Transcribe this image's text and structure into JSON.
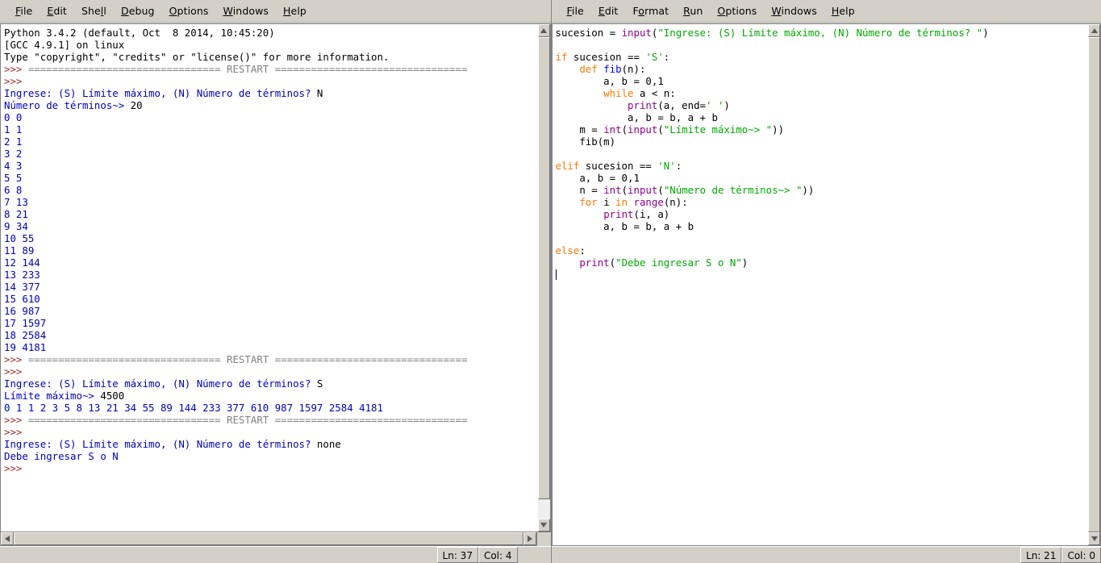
{
  "shell_window": {
    "menu": [
      {
        "label": "File",
        "mnemonic": "F"
      },
      {
        "label": "Edit",
        "mnemonic": "E"
      },
      {
        "label": "Shell",
        "mnemonic": "l"
      },
      {
        "label": "Debug",
        "mnemonic": "D"
      },
      {
        "label": "Options",
        "mnemonic": "O"
      },
      {
        "label": "Windows",
        "mnemonic": "W"
      },
      {
        "label": "Help",
        "mnemonic": "H"
      }
    ],
    "status": {
      "line_label": "Ln: 37",
      "col_label": "Col: 4"
    },
    "lines": [
      [
        {
          "t": "Python 3.4.2 (default, Oct  8 2014, 10:45:20)",
          "c": "normal"
        }
      ],
      [
        {
          "t": "[GCC 4.9.1] on linux",
          "c": "normal"
        }
      ],
      [
        {
          "t": "Type \"copyright\", \"credits\" or \"license()\" for more information.",
          "c": "normal"
        }
      ],
      [
        {
          "t": ">>> ",
          "c": "prompt"
        },
        {
          "t": "================================ RESTART ================================",
          "c": "restart"
        }
      ],
      [
        {
          "t": ">>> ",
          "c": "prompt"
        }
      ],
      [
        {
          "t": "Ingrese: (S) Límite máximo, (N) Número de términos? ",
          "c": "stdout"
        },
        {
          "t": "N",
          "c": "stdin"
        }
      ],
      [
        {
          "t": "Número de términos~> ",
          "c": "stdout"
        },
        {
          "t": "20",
          "c": "stdin"
        }
      ],
      [
        {
          "t": "0 0",
          "c": "stdout"
        }
      ],
      [
        {
          "t": "1 1",
          "c": "stdout"
        }
      ],
      [
        {
          "t": "2 1",
          "c": "stdout"
        }
      ],
      [
        {
          "t": "3 2",
          "c": "stdout"
        }
      ],
      [
        {
          "t": "4 3",
          "c": "stdout"
        }
      ],
      [
        {
          "t": "5 5",
          "c": "stdout"
        }
      ],
      [
        {
          "t": "6 8",
          "c": "stdout"
        }
      ],
      [
        {
          "t": "7 13",
          "c": "stdout"
        }
      ],
      [
        {
          "t": "8 21",
          "c": "stdout"
        }
      ],
      [
        {
          "t": "9 34",
          "c": "stdout"
        }
      ],
      [
        {
          "t": "10 55",
          "c": "stdout"
        }
      ],
      [
        {
          "t": "11 89",
          "c": "stdout"
        }
      ],
      [
        {
          "t": "12 144",
          "c": "stdout"
        }
      ],
      [
        {
          "t": "13 233",
          "c": "stdout"
        }
      ],
      [
        {
          "t": "14 377",
          "c": "stdout"
        }
      ],
      [
        {
          "t": "15 610",
          "c": "stdout"
        }
      ],
      [
        {
          "t": "16 987",
          "c": "stdout"
        }
      ],
      [
        {
          "t": "17 1597",
          "c": "stdout"
        }
      ],
      [
        {
          "t": "18 2584",
          "c": "stdout"
        }
      ],
      [
        {
          "t": "19 4181",
          "c": "stdout"
        }
      ],
      [
        {
          "t": ">>> ",
          "c": "prompt"
        },
        {
          "t": "================================ RESTART ================================",
          "c": "restart"
        }
      ],
      [
        {
          "t": ">>> ",
          "c": "prompt"
        }
      ],
      [
        {
          "t": "Ingrese: (S) Límite máximo, (N) Número de términos? ",
          "c": "stdout"
        },
        {
          "t": "S",
          "c": "stdin"
        }
      ],
      [
        {
          "t": "Límite máximo~> ",
          "c": "stdout"
        },
        {
          "t": "4500",
          "c": "stdin"
        }
      ],
      [
        {
          "t": "0 1 1 2 3 5 8 13 21 34 55 89 144 233 377 610 987 1597 2584 4181 ",
          "c": "stdout"
        }
      ],
      [
        {
          "t": ">>> ",
          "c": "prompt"
        },
        {
          "t": "================================ RESTART ================================",
          "c": "restart"
        }
      ],
      [
        {
          "t": ">>> ",
          "c": "prompt"
        }
      ],
      [
        {
          "t": "Ingrese: (S) Límite máximo, (N) Número de términos? ",
          "c": "stdout"
        },
        {
          "t": "none",
          "c": "stdin"
        }
      ],
      [
        {
          "t": "Debe ingresar S o N",
          "c": "stdout"
        }
      ],
      [
        {
          "t": ">>> ",
          "c": "prompt"
        }
      ]
    ]
  },
  "editor_window": {
    "menu": [
      {
        "label": "File",
        "mnemonic": "F"
      },
      {
        "label": "Edit",
        "mnemonic": "E"
      },
      {
        "label": "Format",
        "mnemonic": "o"
      },
      {
        "label": "Run",
        "mnemonic": "R"
      },
      {
        "label": "Options",
        "mnemonic": "O"
      },
      {
        "label": "Windows",
        "mnemonic": "W"
      },
      {
        "label": "Help",
        "mnemonic": "H"
      }
    ],
    "status": {
      "line_label": "Ln: 21",
      "col_label": "Col: 0"
    },
    "lines": [
      [
        {
          "t": "sucesion = ",
          "c": "normal"
        },
        {
          "t": "input",
          "c": "builtin"
        },
        {
          "t": "(",
          "c": "normal"
        },
        {
          "t": "\"Ingrese: (S) Límite máximo, (N) Número de términos? \"",
          "c": "str"
        },
        {
          "t": ")",
          "c": "normal"
        }
      ],
      [],
      [
        {
          "t": "if",
          "c": "kw"
        },
        {
          "t": " sucesion == ",
          "c": "normal"
        },
        {
          "t": "'S'",
          "c": "str"
        },
        {
          "t": ":",
          "c": "normal"
        }
      ],
      [
        {
          "t": "    ",
          "c": "normal"
        },
        {
          "t": "def",
          "c": "kw"
        },
        {
          "t": " ",
          "c": "normal"
        },
        {
          "t": "fib",
          "c": "def"
        },
        {
          "t": "(n):",
          "c": "normal"
        }
      ],
      [
        {
          "t": "        a, b = 0,1",
          "c": "normal"
        }
      ],
      [
        {
          "t": "        ",
          "c": "normal"
        },
        {
          "t": "while",
          "c": "kw"
        },
        {
          "t": " a < n:",
          "c": "normal"
        }
      ],
      [
        {
          "t": "            ",
          "c": "normal"
        },
        {
          "t": "print",
          "c": "builtin"
        },
        {
          "t": "(a, end=",
          "c": "normal"
        },
        {
          "t": "' '",
          "c": "str"
        },
        {
          "t": ")",
          "c": "normal"
        }
      ],
      [
        {
          "t": "            a, b = b, a + b",
          "c": "normal"
        }
      ],
      [
        {
          "t": "    m = ",
          "c": "normal"
        },
        {
          "t": "int",
          "c": "builtin"
        },
        {
          "t": "(",
          "c": "normal"
        },
        {
          "t": "input",
          "c": "builtin"
        },
        {
          "t": "(",
          "c": "normal"
        },
        {
          "t": "\"Límite máximo~> \"",
          "c": "str"
        },
        {
          "t": "))",
          "c": "normal"
        }
      ],
      [
        {
          "t": "    fib(m)",
          "c": "normal"
        }
      ],
      [],
      [
        {
          "t": "elif",
          "c": "kw"
        },
        {
          "t": " sucesion == ",
          "c": "normal"
        },
        {
          "t": "'N'",
          "c": "str"
        },
        {
          "t": ":",
          "c": "normal"
        }
      ],
      [
        {
          "t": "    a, b = 0,1",
          "c": "normal"
        }
      ],
      [
        {
          "t": "    n = ",
          "c": "normal"
        },
        {
          "t": "int",
          "c": "builtin"
        },
        {
          "t": "(",
          "c": "normal"
        },
        {
          "t": "input",
          "c": "builtin"
        },
        {
          "t": "(",
          "c": "normal"
        },
        {
          "t": "\"Número de términos~> \"",
          "c": "str"
        },
        {
          "t": "))",
          "c": "normal"
        }
      ],
      [
        {
          "t": "    ",
          "c": "normal"
        },
        {
          "t": "for",
          "c": "kw"
        },
        {
          "t": " i ",
          "c": "normal"
        },
        {
          "t": "in",
          "c": "kw"
        },
        {
          "t": " ",
          "c": "normal"
        },
        {
          "t": "range",
          "c": "builtin"
        },
        {
          "t": "(n):",
          "c": "normal"
        }
      ],
      [
        {
          "t": "        ",
          "c": "normal"
        },
        {
          "t": "print",
          "c": "builtin"
        },
        {
          "t": "(i, a)",
          "c": "normal"
        }
      ],
      [
        {
          "t": "        a, b = b, a + b",
          "c": "normal"
        }
      ],
      [],
      [
        {
          "t": "else",
          "c": "kw"
        },
        {
          "t": ":",
          "c": "normal"
        }
      ],
      [
        {
          "t": "    ",
          "c": "normal"
        },
        {
          "t": "print",
          "c": "builtin"
        },
        {
          "t": "(",
          "c": "normal"
        },
        {
          "t": "\"Debe ingresar S o N\"",
          "c": "str"
        },
        {
          "t": ")",
          "c": "normal"
        }
      ],
      [
        {
          "t": "CARET",
          "c": "caret"
        }
      ]
    ]
  },
  "colors": {
    "keyword": "#ff7700",
    "string": "#00aa00",
    "builtin": "#900090",
    "definition": "#0000ff",
    "prompt": "#a52a2a",
    "stdout": "#0000bb",
    "chrome": "#d4d0c8"
  }
}
